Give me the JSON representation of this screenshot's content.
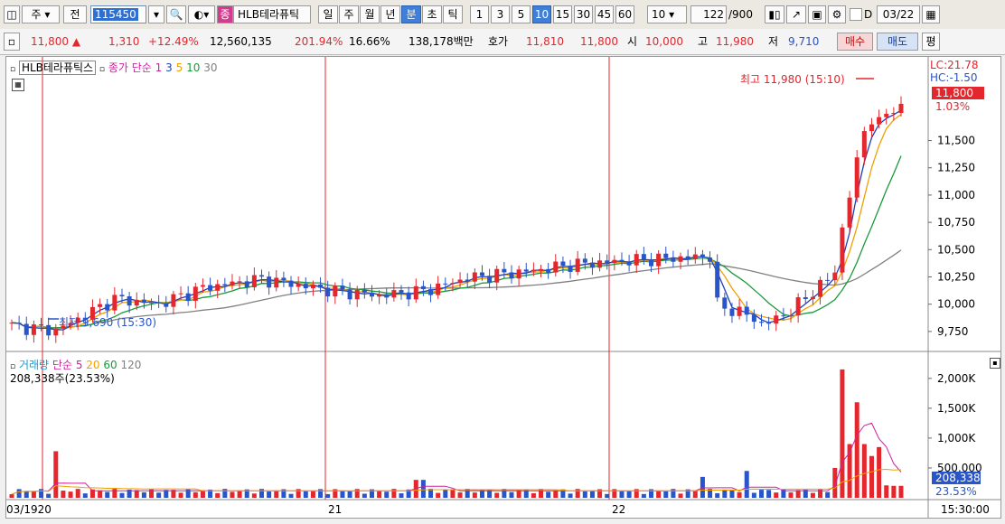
{
  "toolbar": {
    "market": "주",
    "prev_label": "전",
    "stock_code": "115450",
    "stock_name": "HLB테라퓨틱",
    "stock_badge": "종",
    "periods": [
      "일",
      "주",
      "월",
      "년",
      "분",
      "초",
      "틱"
    ],
    "active_period": "분",
    "intervals": [
      "1",
      "3",
      "5",
      "10",
      "15",
      "30",
      "45",
      "60"
    ],
    "active_interval": "10",
    "interval_select": "10",
    "count": "122",
    "count_total": "/900",
    "check_label": "D",
    "date": "03/22"
  },
  "quote": {
    "price": "11,800",
    "arrow": "▲",
    "change": "1,310",
    "change_pct": "+12.49%",
    "volume": "12,560,135",
    "vol_ratio": "201.94%",
    "turnover_pct": "16.66%",
    "amount": "138,178백만",
    "ask_label": "호가",
    "ask": "11,810",
    "bid": "11,800",
    "open_label": "시",
    "open": "10,000",
    "high_label": "고",
    "high": "11,980",
    "low_label": "저",
    "low": "9,710",
    "buy_label": "매수",
    "sell_label": "매도",
    "eval_label": "평"
  },
  "price_panel": {
    "legend_name": "HLB테라퓨틱스",
    "ma_label": "종가 단순",
    "ma_periods": [
      "1",
      "3",
      "5",
      "10",
      "30"
    ],
    "lc": "LC:21.78",
    "hc": "HC:-1.50",
    "last_price": "11,800",
    "last_pct": "1.03%",
    "high_note": "최고 11,980 (15:10)",
    "low_note": "최저 9,690 (15:30)"
  },
  "volume_panel": {
    "legend": "거래량",
    "ma_label": "단순",
    "ma_periods": [
      "5",
      "20",
      "60",
      "120"
    ],
    "last_value": "208,338주(23.53%)",
    "last_box": "208,338",
    "last_pct": "23.53%"
  },
  "x_axis": {
    "start": "03/19",
    "d1": "20",
    "d2": "21",
    "d3": "22",
    "end_time": "15:30:00"
  },
  "colors": {
    "up": "#e4262d",
    "down": "#2855c9",
    "ma3": "#1f3fb8",
    "ma5": "#f0a000",
    "ma10": "#1a9a3a",
    "ma30": "#808080",
    "pink": "#d020a0",
    "blue_sel": "#3f7fd8"
  },
  "chart_data": {
    "type": "candlestick",
    "price_axis_ticks": [
      11500,
      11250,
      11000,
      10750,
      10500,
      10250,
      10000,
      9750
    ],
    "price_ylim": [
      9600,
      12200
    ],
    "volume_axis_ticks": [
      "2,000K",
      "1,500K",
      "1,000K",
      "500,000"
    ],
    "volume_ylim": [
      0,
      2300000
    ],
    "days": [
      "03/19",
      "20",
      "21",
      "22"
    ],
    "bars_estimate": 122
  }
}
